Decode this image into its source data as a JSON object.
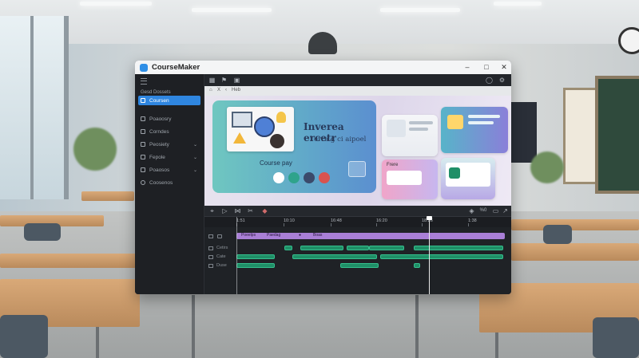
{
  "app": {
    "title": "CourseMaker",
    "window_controls": [
      "minimize",
      "maximize",
      "close"
    ]
  },
  "sidebar": {
    "section_label": "Gesd Dossets",
    "items": [
      {
        "label": "Coursen",
        "icon": "course-icon",
        "active": true
      },
      {
        "label": "Poaoosry",
        "icon": "folder-icon",
        "active": false
      },
      {
        "label": "Corndes",
        "icon": "grid-icon",
        "active": false
      },
      {
        "label": "Peosiety",
        "icon": "people-icon",
        "active": false,
        "expandable": true
      },
      {
        "label": "Fepole",
        "icon": "star-icon",
        "active": false,
        "expandable": true
      },
      {
        "label": "Poaosos",
        "icon": "document-icon",
        "active": false,
        "expandable": true
      },
      {
        "label": "Coosenos",
        "icon": "gear-icon",
        "active": false
      }
    ]
  },
  "toolbar": {
    "icons": [
      "grid-icon",
      "flag-icon",
      "layout-icon"
    ],
    "right_icons": [
      "history-icon",
      "settings-icon"
    ]
  },
  "preview": {
    "breadcrumb": "X",
    "tab": "Heb",
    "main_slide": {
      "title": "Inverea ercetr",
      "subtitle": "Terra g ci aipoel",
      "button_text": "Course pay"
    },
    "cards": [
      {
        "label": "",
        "colors": [
          "#f5f6f8",
          "#e9ecf1"
        ]
      },
      {
        "label": "",
        "colors": [
          "#57b4c9",
          "#8a7fd9"
        ]
      },
      {
        "label": "Frere",
        "colors": [
          "#f0a5c9",
          "#c7b7ef"
        ]
      },
      {
        "label": "",
        "colors": [
          "#d7ecef",
          "#b8a9e6"
        ]
      }
    ]
  },
  "timeline": {
    "ruler": [
      "1:51",
      "10:10",
      "16:48",
      "16:20",
      "18:26",
      "1:38"
    ],
    "tracks": [
      {
        "label": "",
        "clips": [
          "Poeelps",
          "Paedag",
          "Boas"
        ]
      },
      {
        "label": "Cetirs"
      },
      {
        "label": "Cate"
      },
      {
        "label": "Duse"
      }
    ],
    "zoom_label": "%0"
  },
  "colors": {
    "accent": "#2f86e0",
    "track_purple": "#a97fd6",
    "track_green": "#1f8f67"
  }
}
